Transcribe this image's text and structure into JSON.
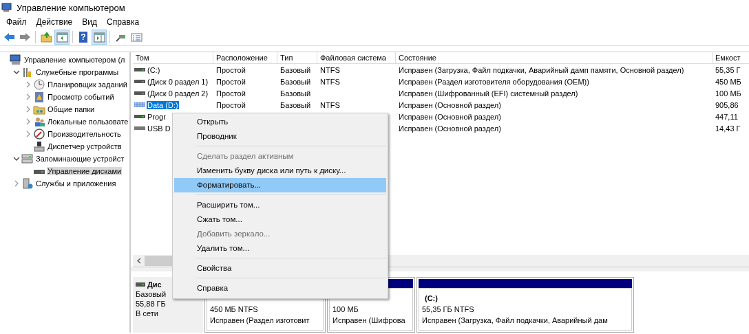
{
  "window": {
    "title": "Управление компьютером"
  },
  "menu_bar": [
    "Файл",
    "Действие",
    "Вид",
    "Справка"
  ],
  "toolbar": [
    {
      "kind": "back",
      "pressed": false
    },
    {
      "kind": "forward",
      "pressed": false
    },
    {
      "kind": "sep"
    },
    {
      "kind": "up",
      "pressed": false
    },
    {
      "kind": "tree",
      "pressed": true
    },
    {
      "kind": "sep"
    },
    {
      "kind": "help",
      "pressed": false,
      "glyph": "?"
    },
    {
      "kind": "action",
      "pressed": true
    },
    {
      "kind": "sep"
    },
    {
      "kind": "connect",
      "pressed": false
    },
    {
      "kind": "props",
      "pressed": false
    }
  ],
  "tree": [
    {
      "label": "Управление компьютером (л",
      "kind": "computer",
      "selected": false,
      "children": [
        {
          "label": "Служебные программы",
          "kind": "tools",
          "expanded": true,
          "selected": false,
          "children": [
            {
              "label": "Планировщик заданий",
              "kind": "clock",
              "expanded": false,
              "selected": false
            },
            {
              "label": "Просмотр событий",
              "kind": "log",
              "expanded": false,
              "selected": false
            },
            {
              "label": "Общие папки",
              "kind": "share",
              "expanded": false,
              "selected": false
            },
            {
              "label": "Локальные пользовате",
              "kind": "users",
              "expanded": false,
              "selected": false
            },
            {
              "label": "Производительность",
              "kind": "perf",
              "expanded": false,
              "selected": false
            },
            {
              "label": "Диспетчер устройств",
              "kind": "devices",
              "selected": false
            }
          ]
        },
        {
          "label": "Запоминающие устройст",
          "kind": "storage",
          "expanded": true,
          "selected": false,
          "children": [
            {
              "label": "Управление дисками",
              "kind": "disk",
              "selected": true
            }
          ]
        },
        {
          "label": "Службы и приложения",
          "kind": "services",
          "expanded": false,
          "selected": false
        }
      ]
    }
  ],
  "table": {
    "columns": [
      "Том",
      "Расположение",
      "Тип",
      "Файловая система",
      "Состояние",
      "Емкост"
    ],
    "rows": [
      {
        "kind": "fixed",
        "selected": false,
        "cells": [
          " (C:)",
          "Простой",
          "Базовый",
          "NTFS",
          "Исправен (Загрузка, Файл подкачки, Аварийный дамп памяти, Основной раздел)",
          "55,35 Г"
        ]
      },
      {
        "kind": "fixed",
        "selected": false,
        "cells": [
          "(Диск 0 раздел 1)",
          "Простой",
          "Базовый",
          "NTFS",
          "Исправен (Раздел изготовителя оборудования (OEM))",
          "450 МБ"
        ]
      },
      {
        "kind": "fixed",
        "selected": false,
        "cells": [
          "(Диск 0 раздел 2)",
          "Простой",
          "Базовый",
          null,
          "Исправен (Шифрованный (EFI) системный раздел)",
          "100 МБ"
        ]
      },
      {
        "kind": "fixed",
        "selected": true,
        "cells": [
          "Data (D:)",
          "Простой",
          "Базовый",
          "NTFS",
          "Исправен (Основной раздел)",
          "905,86"
        ]
      },
      {
        "kind": "fixed",
        "selected": false,
        "cells": [
          "Progr",
          null,
          null,
          null,
          "Исправен (Основной раздел)",
          "447,11"
        ]
      },
      {
        "kind": "removable",
        "selected": false,
        "cells": [
          "USB D",
          null,
          null,
          null,
          "Исправен (Основной раздел)",
          "14,43 Г"
        ]
      }
    ]
  },
  "disk": {
    "name": "Дис",
    "type": "Базовый",
    "size": "55,88 ГБ",
    "state": "В сети",
    "partitions": [
      {
        "size": "450 МБ NTFS",
        "status": "Исправен (Раздел изготовит"
      },
      {
        "size": "100 МБ",
        "status": "Исправен (Шифрова"
      },
      {
        "name": "(C:)",
        "size": "55,35 ГБ NTFS",
        "status": "Исправен (Загрузка, Файл подкачки, Аварийный дам"
      }
    ]
  },
  "context_menu": [
    {
      "kind": "item",
      "label": "Открыть",
      "disabled": false,
      "selected": false
    },
    {
      "kind": "item",
      "label": "Проводник",
      "disabled": false,
      "selected": false
    },
    {
      "kind": "separator"
    },
    {
      "kind": "item",
      "label": "Сделать раздел активным",
      "disabled": true,
      "selected": false
    },
    {
      "kind": "item",
      "label": "Изменить букву диска или путь к диску...",
      "disabled": false,
      "selected": false
    },
    {
      "kind": "item",
      "label": "Форматировать...",
      "disabled": false,
      "selected": true
    },
    {
      "kind": "separator"
    },
    {
      "kind": "item",
      "label": "Расширить том...",
      "disabled": false,
      "selected": false
    },
    {
      "kind": "item",
      "label": "Сжать том...",
      "disabled": false,
      "selected": false
    },
    {
      "kind": "item",
      "label": "Добавить зеркало...",
      "disabled": true,
      "selected": false
    },
    {
      "kind": "item",
      "label": "Удалить том...",
      "disabled": false,
      "selected": false
    },
    {
      "kind": "separator"
    },
    {
      "kind": "item",
      "label": "Свойства",
      "disabled": false,
      "selected": false
    },
    {
      "kind": "separator"
    },
    {
      "kind": "item",
      "label": "Справка",
      "disabled": false,
      "selected": false
    }
  ]
}
